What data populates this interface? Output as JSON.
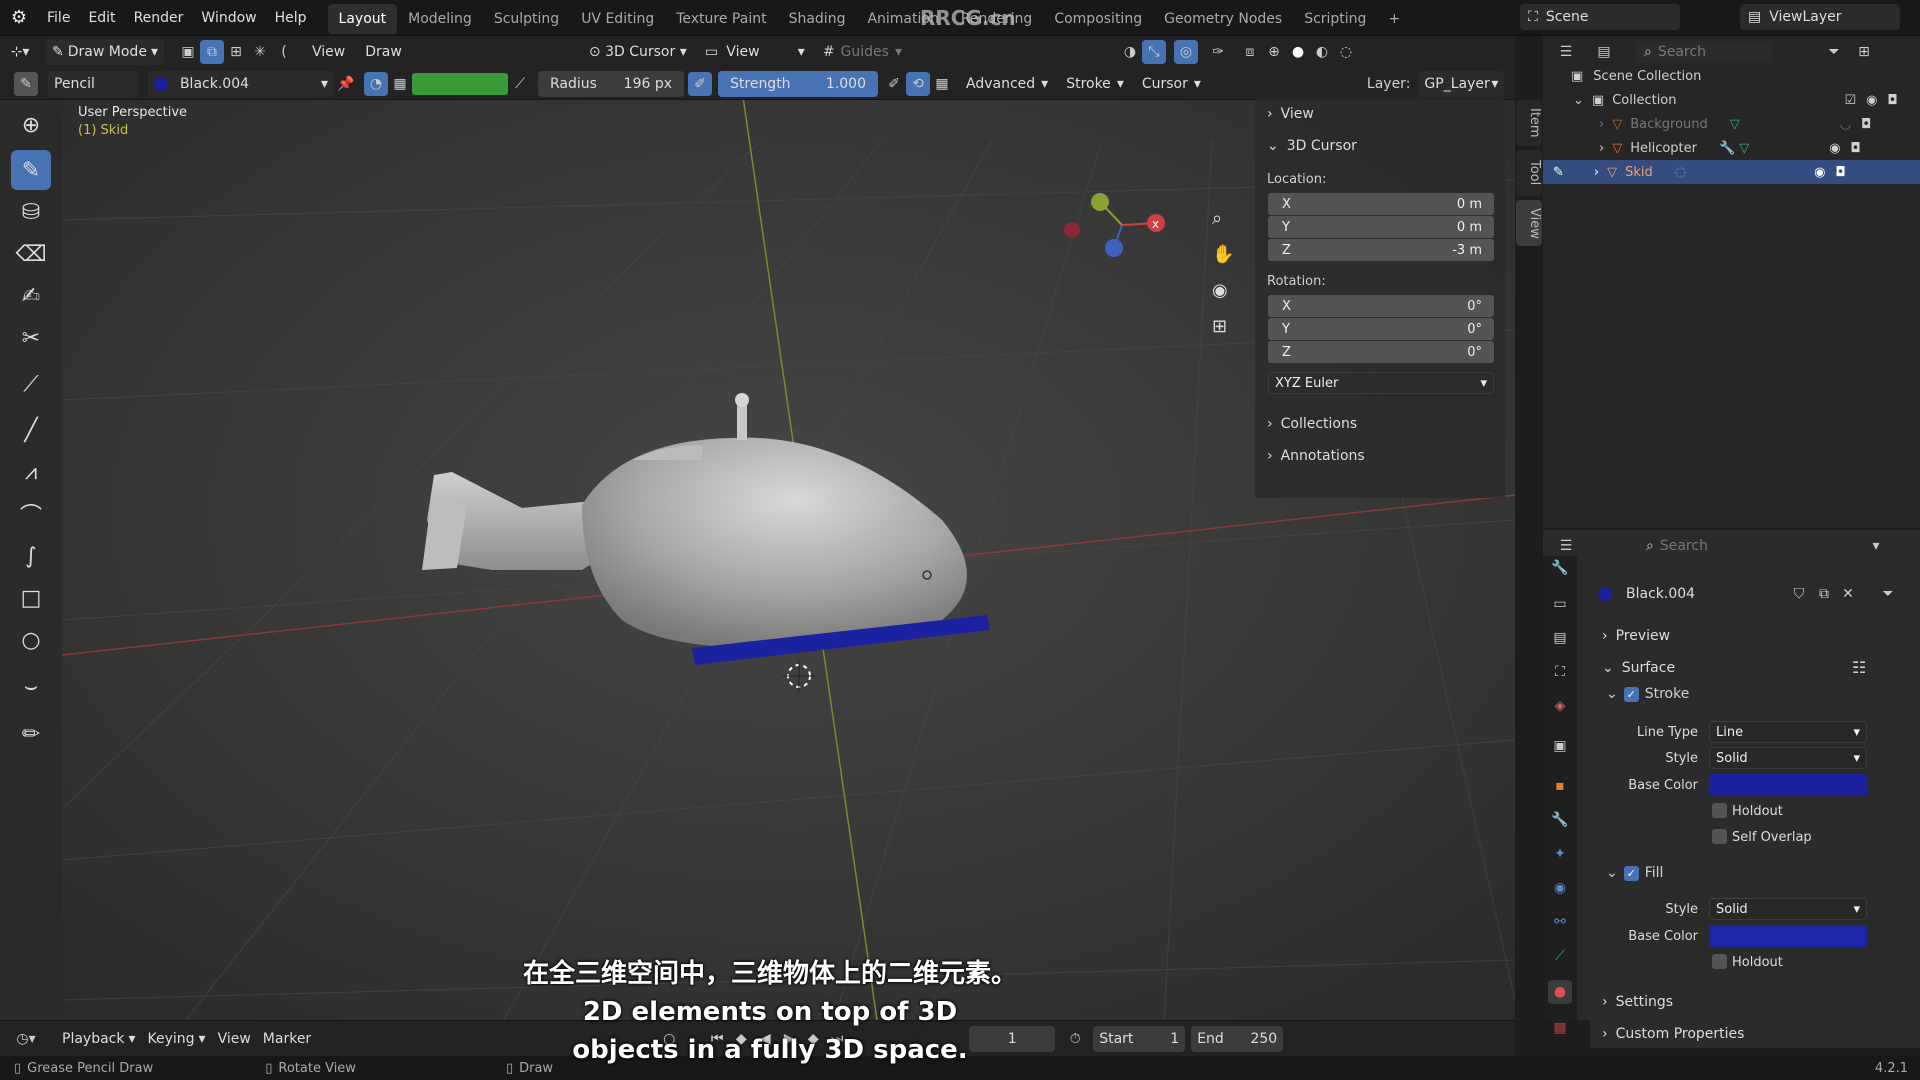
{
  "topbar": {
    "menus": [
      "File",
      "Edit",
      "Render",
      "Window",
      "Help"
    ],
    "workspaces": [
      "Layout",
      "Modeling",
      "Sculpting",
      "UV Editing",
      "Texture Paint",
      "Shading",
      "Animation",
      "Rendering",
      "Compositing",
      "Geometry Nodes",
      "Scripting"
    ],
    "active_workspace": "Layout",
    "watermark": "RRCG.cn",
    "scene": "Scene",
    "view_layer": "ViewLayer"
  },
  "header1": {
    "mode": "Draw Mode",
    "view_menu": "View",
    "draw_menu": "Draw",
    "cursor_select": "3D Cursor",
    "view_select": "View",
    "guides": "Guides"
  },
  "header2": {
    "brush": "Pencil",
    "material": "Black.004",
    "radius_label": "Radius",
    "radius_value": "196 px",
    "strength_label": "Strength",
    "strength_value": "1.000",
    "advanced": "Advanced",
    "stroke": "Stroke",
    "cursor": "Cursor",
    "layer_label": "Layer:",
    "layer_value": "GP_Layer"
  },
  "viewport": {
    "perspective": "User Perspective",
    "object": "(1) Skid"
  },
  "npanel": {
    "view": "View",
    "cursor_title": "3D Cursor",
    "location_label": "Location:",
    "loc": [
      {
        "axis": "X",
        "val": "0 m"
      },
      {
        "axis": "Y",
        "val": "0 m"
      },
      {
        "axis": "Z",
        "val": "-3 m"
      }
    ],
    "rotation_label": "Rotation:",
    "rot": [
      {
        "axis": "X",
        "val": "0°"
      },
      {
        "axis": "Y",
        "val": "0°"
      },
      {
        "axis": "Z",
        "val": "0°"
      }
    ],
    "rotation_mode": "XYZ Euler",
    "collections": "Collections",
    "annotations": "Annotations",
    "tabs": [
      "Item",
      "Tool",
      "View"
    ]
  },
  "outliner": {
    "search_placeholder": "Search",
    "scene_collection": "Scene Collection",
    "collection": "Collection",
    "items": [
      "Background",
      "Helicopter",
      "Skid"
    ]
  },
  "properties": {
    "search_placeholder": "Search",
    "material": "Black.004",
    "preview": "Preview",
    "surface": "Surface",
    "stroke": "Stroke",
    "line_type_label": "Line Type",
    "line_type": "Line",
    "style_label": "Style",
    "stroke_style": "Solid",
    "base_color_label": "Base Color",
    "holdout": "Holdout",
    "self_overlap": "Self Overlap",
    "fill": "Fill",
    "fill_style": "Solid",
    "settings": "Settings",
    "custom_properties": "Custom Properties",
    "stroke_color": "#1a22a0",
    "fill_color": "#1e27a8"
  },
  "timeline": {
    "playback": "Playback",
    "keying": "Keying",
    "view": "View",
    "marker": "Marker",
    "current_frame": "1",
    "start_label": "Start",
    "start": "1",
    "end_label": "End",
    "end": "250"
  },
  "status": {
    "left": "Grease Pencil Draw",
    "mid": "Rotate View",
    "right": "Draw",
    "version": "4.2.1"
  },
  "subtitles": {
    "zh": "在全三维空间中，三维物体上的二维元素。",
    "en1": "2D elements on top of 3D",
    "en2": "objects in a fully 3D space."
  }
}
